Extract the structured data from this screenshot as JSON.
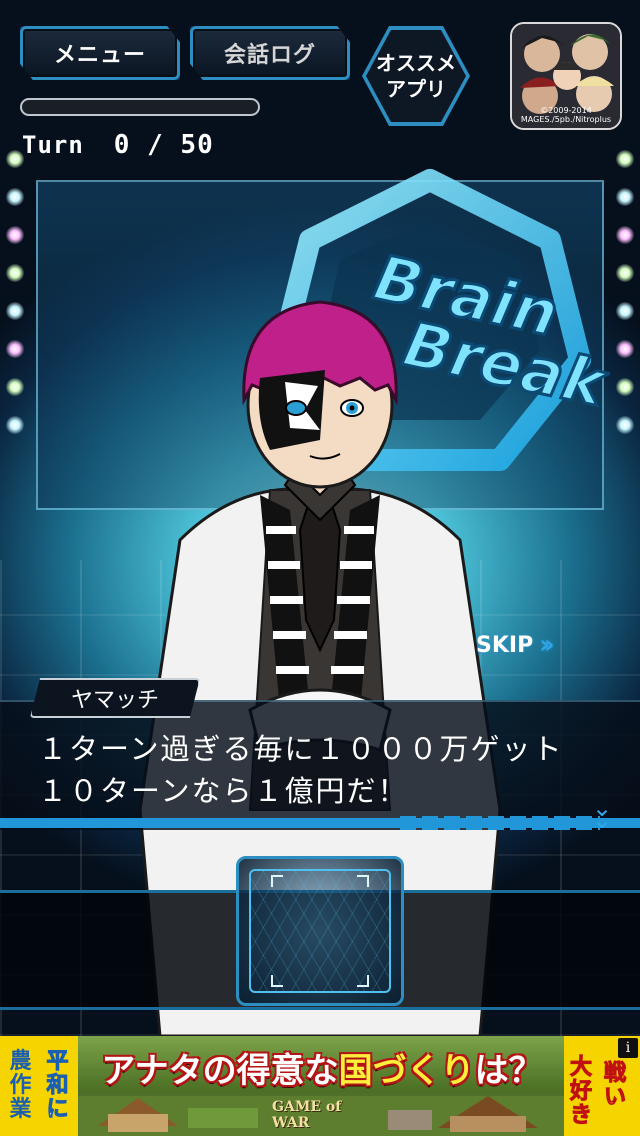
{
  "hud": {
    "menu_label": "メニュー",
    "log_label": "会話ログ",
    "recommend_line1": "オススメ",
    "recommend_line2": "アプリ",
    "thumb_copyright": "©2009-2014 MAGES./5pb./Nitroplus",
    "progress_fraction": 0.0
  },
  "turn": {
    "label": "Turn",
    "current": "0",
    "total": "50",
    "display": "0 / 50"
  },
  "logo": {
    "line1": "Brain",
    "line2": "Break"
  },
  "skip_label": "SKIP",
  "dialogue": {
    "speaker": "ヤマッチ",
    "line1": "１ターン過ぎる毎に１０００万ゲット",
    "line2": "１０ターンなら１億円だ！"
  },
  "ad": {
    "left_col1": [
      "農",
      "作",
      "業"
    ],
    "left_col2": [
      "平",
      "和",
      "に"
    ],
    "headline_pre": "アナタの得意な",
    "headline_red": "国づくり",
    "headline_post": "は？",
    "logo_text": "GAME of WAR",
    "right_col1": [
      "大",
      "好",
      "き"
    ],
    "right_col2": [
      "戦",
      "い"
    ],
    "info": "i"
  },
  "colors": {
    "accent": "#2d8ec2",
    "dialog_bar": "#2196d8",
    "hair": "#c0208a",
    "ad_yellow": "#f5d400"
  }
}
